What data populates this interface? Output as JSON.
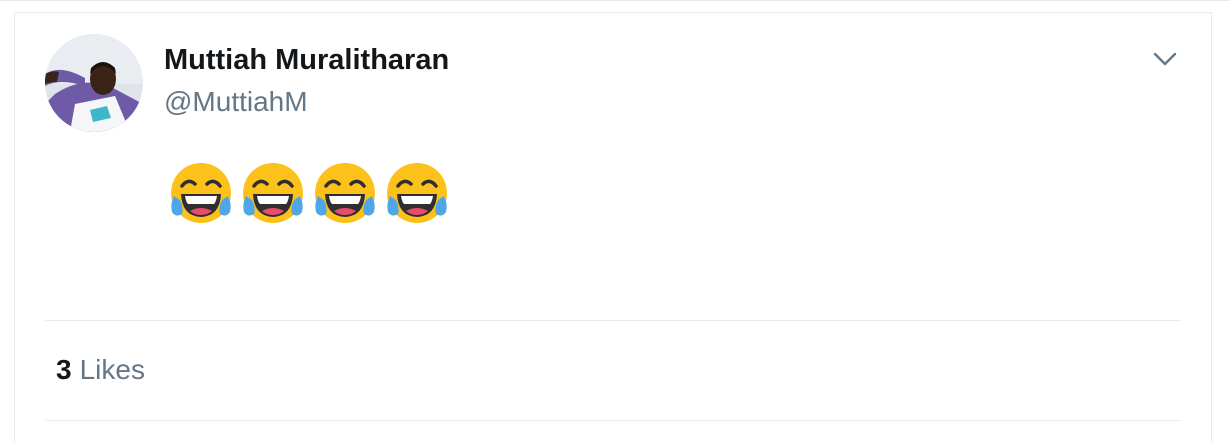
{
  "tweet": {
    "author": {
      "display_name": "Muttiah Muralitharan",
      "handle": "@MuttiahM",
      "avatar_icon": "user-avatar-photo"
    },
    "menu_icon": "chevron-down-icon",
    "text": "😂😂😂😂",
    "emoji_count": 4,
    "emoji_name": "face-with-tears-of-joy-icon",
    "likes": {
      "count": "3",
      "label": "Likes"
    }
  },
  "colors": {
    "text_primary": "#14171a",
    "text_secondary": "#657786",
    "border": "#e6ecf0",
    "caret": "#657786",
    "emoji_face": "#fcc21b",
    "emoji_tears": "#4fa6e8"
  }
}
